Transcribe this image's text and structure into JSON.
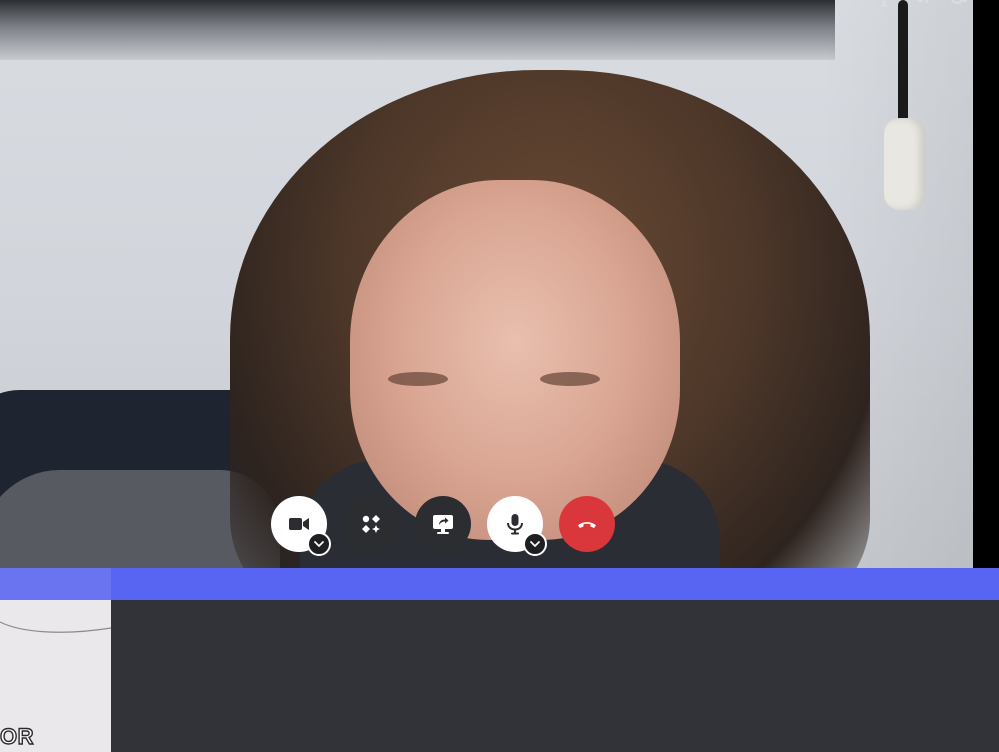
{
  "call": {
    "controls": [
      {
        "name": "camera-toggle-button",
        "icon": "video-camera-icon",
        "style": "light",
        "has_caret": true
      },
      {
        "name": "activities-button",
        "icon": "activities-rocket-icon",
        "style": "dark",
        "has_caret": false
      },
      {
        "name": "screen-share-button",
        "icon": "screen-share-icon",
        "style": "dark",
        "has_caret": false
      },
      {
        "name": "microphone-button",
        "icon": "microphone-icon",
        "style": "light",
        "has_caret": true
      },
      {
        "name": "disconnect-button",
        "icon": "hang-up-phone-icon",
        "style": "red",
        "has_caret": false
      }
    ],
    "colors": {
      "accent": "#5865f2",
      "disconnect": "#da373c",
      "background": "#313338",
      "control_dark": "#2b2d31"
    }
  },
  "thumbnail": {
    "label": "OR"
  }
}
